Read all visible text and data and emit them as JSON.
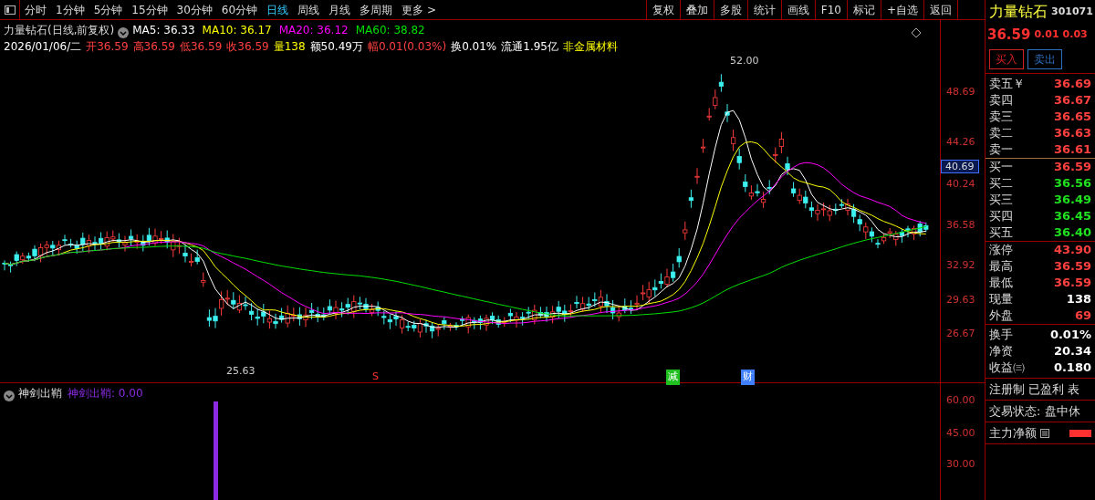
{
  "toolbar": {
    "periods": [
      {
        "label": "分时",
        "selected": false
      },
      {
        "label": "1分钟",
        "selected": false
      },
      {
        "label": "5分钟",
        "selected": false
      },
      {
        "label": "15分钟",
        "selected": false
      },
      {
        "label": "30分钟",
        "selected": false
      },
      {
        "label": "60分钟",
        "selected": false
      },
      {
        "label": "日线",
        "selected": true
      },
      {
        "label": "周线",
        "selected": false
      },
      {
        "label": "月线",
        "selected": false
      },
      {
        "label": "多周期",
        "selected": false
      },
      {
        "label": "更多 >",
        "selected": false
      }
    ],
    "actions": [
      "复权",
      "叠加",
      "多股",
      "统计",
      "画线",
      "F10",
      "标记",
      "+自选",
      "返回"
    ]
  },
  "chart": {
    "title": "力量钻石(日线,前复权)",
    "ma": [
      {
        "label": "MA5: 36.33",
        "color": "#ffffff"
      },
      {
        "label": "MA10: 36.17",
        "color": "#ffff00"
      },
      {
        "label": "MA20: 36.12",
        "color": "#ff00ff"
      },
      {
        "label": "MA60: 38.82",
        "color": "#00e000"
      }
    ],
    "quote": [
      {
        "text": "2026/01/06/二",
        "color": "#ffffff"
      },
      {
        "text": "开36.59",
        "color": "#ff4040"
      },
      {
        "text": "高36.59",
        "color": "#ff4040"
      },
      {
        "text": "低36.59",
        "color": "#ff4040"
      },
      {
        "text": "收36.59",
        "color": "#ff4040"
      },
      {
        "text": "量138",
        "color": "#ffff00"
      },
      {
        "text": "额50.49万",
        "color": "#ffffff"
      },
      {
        "text": "幅0.01(0.03%)",
        "color": "#ff4040"
      },
      {
        "text": "换0.01%",
        "color": "#ffffff"
      },
      {
        "text": "流通1.95亿",
        "color": "#ffffff"
      },
      {
        "text": "非金属材料",
        "color": "#ffff00"
      }
    ],
    "price_axis": [
      "48.69",
      "44.26",
      "40.24",
      "36.58",
      "32.92",
      "29.63",
      "26.67"
    ],
    "price_tag": "40.69",
    "high_label": "52.00",
    "low_label": "25.63",
    "events": [
      {
        "text": "S",
        "color": "#ff3030"
      },
      {
        "text": "减",
        "color": "#20c020"
      },
      {
        "text": "财",
        "color": "#4080ff"
      }
    ]
  },
  "indicator": {
    "title": "神剑出鞘",
    "value": "神剑出鞘: 0.00",
    "axis": [
      "60.00",
      "45.00",
      "30.00"
    ]
  },
  "quote_panel": {
    "name": "力量钻石",
    "code": "301071",
    "price": "36.59",
    "change": "0.01",
    "change_pct": "0.03",
    "buttons": [
      {
        "label": "买入",
        "kind": "buy"
      },
      {
        "label": "卖出",
        "kind": "sell"
      }
    ],
    "sell_orders": [
      {
        "label": "卖五￥",
        "price": "36.69",
        "color": "#ff4040"
      },
      {
        "label": "卖四",
        "price": "36.67",
        "color": "#ff4040"
      },
      {
        "label": "卖三",
        "price": "36.65",
        "color": "#ff4040"
      },
      {
        "label": "卖二",
        "price": "36.63",
        "color": "#ff4040"
      },
      {
        "label": "卖一",
        "price": "36.61",
        "color": "#ff4040"
      }
    ],
    "buy_orders": [
      {
        "label": "买一",
        "price": "36.59",
        "color": "#ff4040"
      },
      {
        "label": "买二",
        "price": "36.56",
        "color": "#20e020"
      },
      {
        "label": "买三",
        "price": "36.49",
        "color": "#20e020"
      },
      {
        "label": "买四",
        "price": "36.45",
        "color": "#20e020"
      },
      {
        "label": "买五",
        "price": "36.40",
        "color": "#20e020"
      }
    ],
    "stats": [
      {
        "label": "涨停",
        "value": "43.90",
        "color": "#ff4040"
      },
      {
        "label": "最高",
        "value": "36.59",
        "color": "#ff4040"
      },
      {
        "label": "最低",
        "value": "36.59",
        "color": "#ff4040"
      },
      {
        "label": "现量",
        "value": "138",
        "color": "#ffffff"
      },
      {
        "label": "外盘",
        "value": "69",
        "color": "#ff4040"
      }
    ],
    "stats2": [
      {
        "label": "换手",
        "value": "0.01%",
        "color": "#ffffff"
      },
      {
        "label": "净资",
        "value": "20.34",
        "color": "#ffffff"
      },
      {
        "label": "收益㈢",
        "value": "0.180",
        "color": "#ffffff"
      }
    ],
    "tags": "注册制 已盈利 表",
    "status": "交易状态: 盘中休",
    "flow": "主力净额"
  }
}
